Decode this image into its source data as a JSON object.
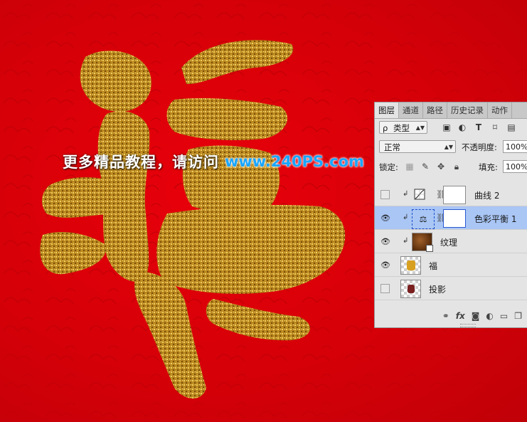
{
  "watermark": {
    "text_cn": "更多精品教程，请访问",
    "url": "www.240PS.com"
  },
  "canvas": {
    "background_color": "#d80008",
    "glyph_color": "#c89a2c",
    "glyph": "福"
  },
  "layers_panel": {
    "tabs": [
      {
        "label": "图层",
        "active": true
      },
      {
        "label": "通道",
        "active": false
      },
      {
        "label": "路径",
        "active": false
      },
      {
        "label": "历史记录",
        "active": false
      },
      {
        "label": "动作",
        "active": false
      }
    ],
    "filter": {
      "search_icon": "ρ",
      "kind_label": "类型",
      "filter_icons": [
        "image-filter-icon",
        "adjustment-filter-icon",
        "type-filter-icon",
        "shape-filter-icon",
        "smart-object-filter-icon"
      ]
    },
    "blend_mode": "正常",
    "opacity_label": "不透明度:",
    "opacity_value": "100%",
    "lock_label": "锁定:",
    "fill_label": "填充:",
    "fill_value": "100%",
    "layers": [
      {
        "name": "曲线 2",
        "visible": false,
        "type": "curves",
        "clipped": true,
        "selected": false
      },
      {
        "name": "色彩平衡 1",
        "visible": true,
        "type": "color-balance",
        "clipped": true,
        "selected": true
      },
      {
        "name": "纹理",
        "visible": true,
        "type": "texture",
        "clipped": true,
        "selected": false
      },
      {
        "name": "福",
        "visible": true,
        "type": "pixel",
        "clipped": false,
        "selected": false
      },
      {
        "name": "投影",
        "visible": false,
        "type": "pixel",
        "clipped": false,
        "selected": false
      }
    ],
    "bottom_icons": [
      "link-icon",
      "fx-icon",
      "mask-icon",
      "adjustment-icon",
      "folder-icon",
      "new-layer-icon"
    ],
    "fx_label": "fx"
  }
}
